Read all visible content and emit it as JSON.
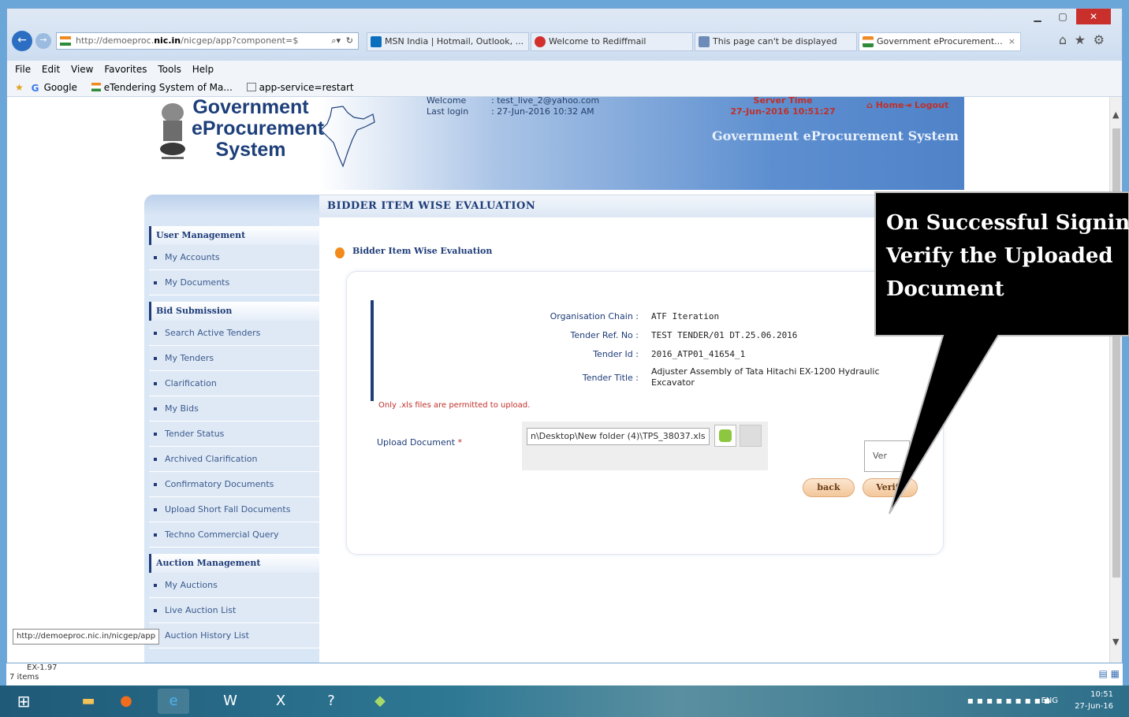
{
  "browser": {
    "address_url_prefix": "http://demoeproc.",
    "address_url_host": "nic.in",
    "address_url_rest": "/nicgep/app?component=$",
    "tabs": [
      {
        "title": "MSN India | Hotmail, Outlook, ..."
      },
      {
        "title": "Welcome to Rediffmail"
      },
      {
        "title": "This page can't be displayed"
      },
      {
        "title": "Government eProcurement..."
      }
    ],
    "menu": [
      "File",
      "Edit",
      "View",
      "Favorites",
      "Tools",
      "Help"
    ],
    "favorites": [
      "Google",
      "eTendering System of Ma...",
      "app-service=restart"
    ]
  },
  "header": {
    "logo_line1": "Government",
    "logo_line2": "eProcurement",
    "logo_line3": "System",
    "welcome_label": "Welcome",
    "welcome_value": ": test_live_2@yahoo.com",
    "lastlogin_label": "Last login",
    "lastlogin_value": ": 27-Jun-2016 10:32 AM",
    "server_time_label": "Server Time",
    "server_time_value": "27-Jun-2016 10:51:27",
    "home": "Home",
    "logout": "Logout",
    "subtitle": "Government eProcurement System"
  },
  "sidebar": {
    "sections": [
      {
        "title": "User Management",
        "items": [
          "My Accounts",
          "My Documents"
        ]
      },
      {
        "title": "Bid Submission",
        "items": [
          "Search Active Tenders",
          "My Tenders",
          "Clarification",
          "My Bids",
          "Tender Status",
          "Archived Clarification",
          "Confirmatory Documents",
          "Upload Short Fall Documents",
          "Techno Commercial Query"
        ]
      },
      {
        "title": "Auction Management",
        "items": [
          "My Auctions",
          "Live Auction List",
          "Auction History List"
        ]
      }
    ]
  },
  "main": {
    "page_title": "BIDDER ITEM WISE EVALUATION",
    "section_title": "Bidder Item Wise Evaluation",
    "details": [
      {
        "label": "Organisation Chain :",
        "value": "ATF Iteration"
      },
      {
        "label": "Tender Ref. No :",
        "value": "TEST TENDER/01 DT.25.06.2016"
      },
      {
        "label": "Tender Id :",
        "value": "2016_ATP01_41654_1"
      },
      {
        "label": "Tender Title :",
        "value": "Adjuster Assembly of Tata Hitachi EX-1200 Hydraulic Excavator"
      }
    ],
    "upload_note": "Only .xls files are permitted to upload.",
    "upload_label": "Upload Document",
    "upload_required": "*",
    "file_value": "n\\Desktop\\New folder (4)\\TPS_38037.xls",
    "verify_small": "Ver",
    "back_button": "back",
    "verify_button": "Verify"
  },
  "callout": {
    "line1": "On Successful Signing",
    "line2": "Verify the Uploaded",
    "line3": "Document"
  },
  "status": {
    "link_tip": "http://demoeproc.nic.in/nicgep/app",
    "desktop_item": "EX-1.97",
    "items_count": "7 items"
  },
  "taskbar": {
    "lang": "ENG",
    "time": "10:51",
    "date": "27-Jun-16"
  }
}
